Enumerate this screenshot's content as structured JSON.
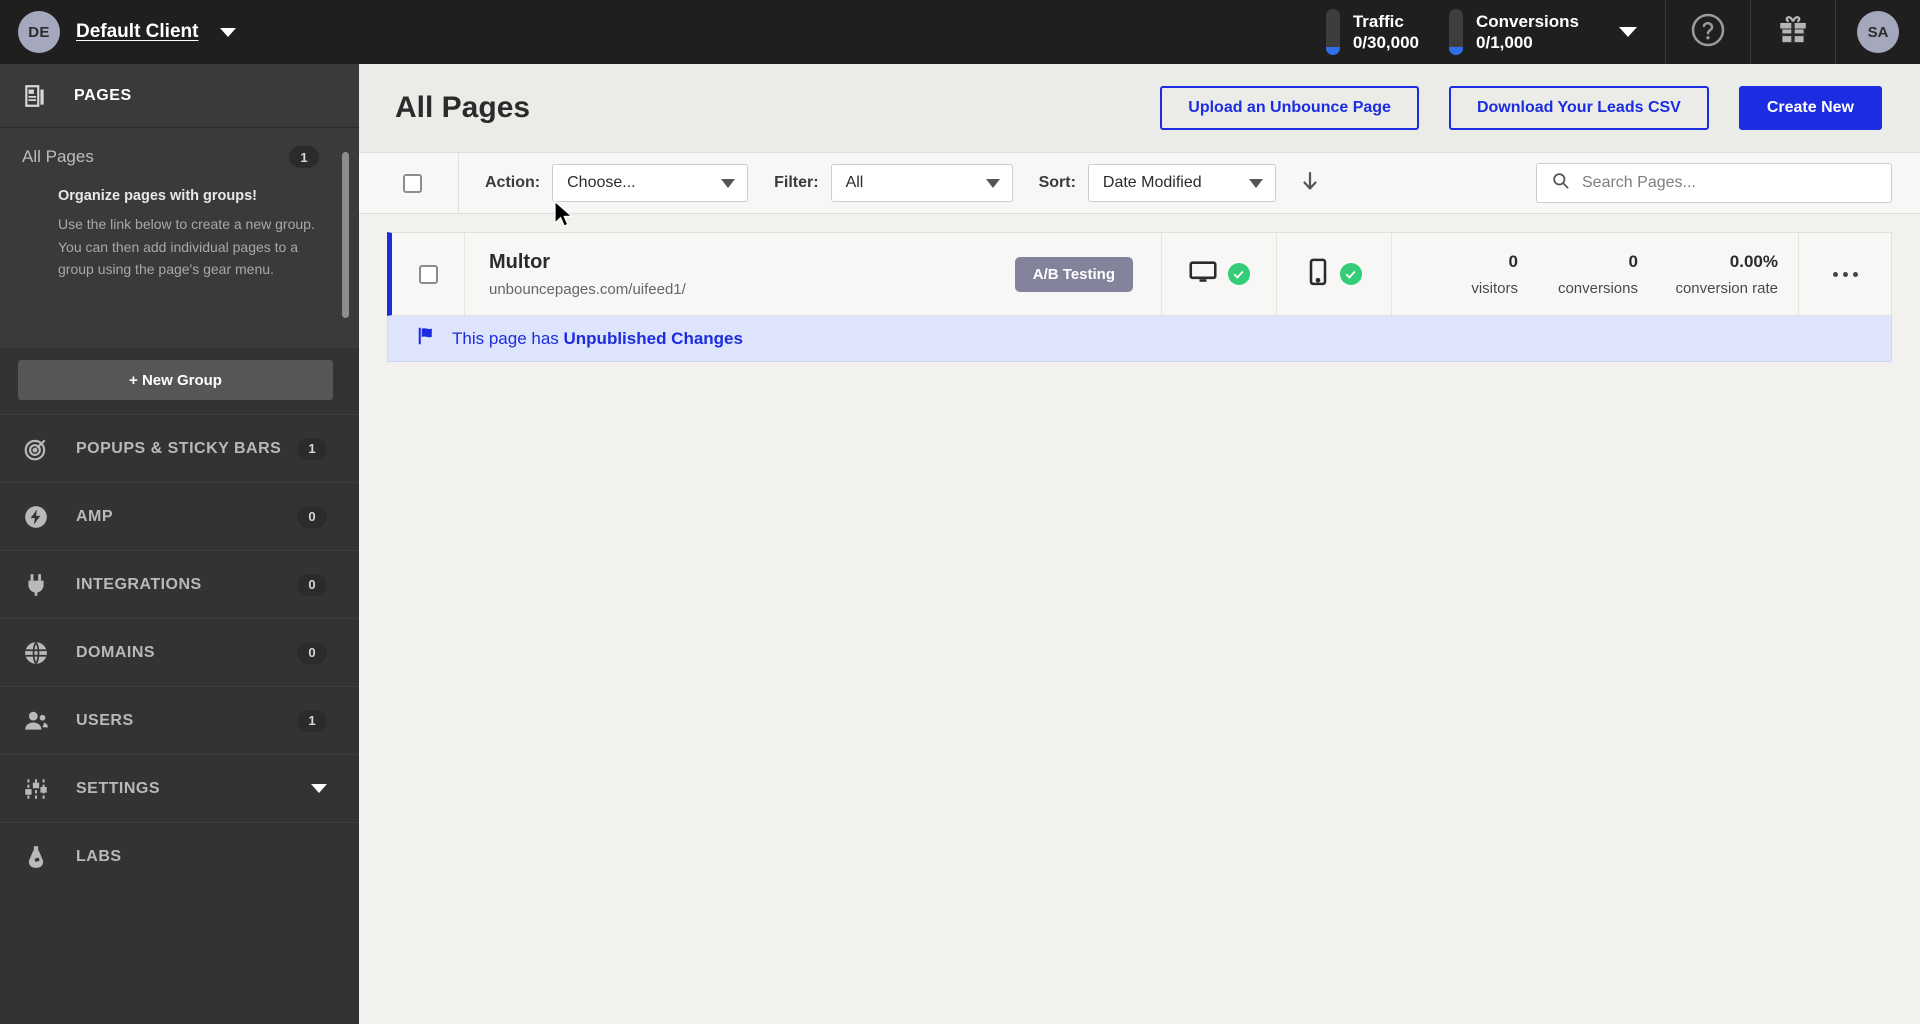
{
  "client": {
    "initials": "DE",
    "name": "Default Client",
    "caret_icon": "chevron-down-icon"
  },
  "sidebar": {
    "section_title": "PAGES",
    "section_icon": "pages-icon",
    "all_pages": {
      "label": "All Pages",
      "badge": "1"
    },
    "organize": {
      "title": "Organize pages with groups!",
      "text": "Use the link below to create a new group. You can then add individual pages to a group using the page's gear menu."
    },
    "new_group_label": "+ New Group",
    "items": [
      {
        "label": "POPUPS & STICKY BARS",
        "badge": "1",
        "icon": "target-icon"
      },
      {
        "label": "AMP",
        "badge": "0",
        "icon": "bolt-icon"
      },
      {
        "label": "INTEGRATIONS",
        "badge": "0",
        "icon": "plug-icon"
      },
      {
        "label": "DOMAINS",
        "badge": "0",
        "icon": "globe-icon"
      },
      {
        "label": "USERS",
        "badge": "1",
        "icon": "users-icon"
      },
      {
        "label": "SETTINGS",
        "badge": "",
        "icon": "sliders-icon"
      },
      {
        "label": "LABS",
        "badge": "",
        "icon": "flask-icon"
      }
    ]
  },
  "topbar": {
    "meters": [
      {
        "label": "Traffic",
        "value": "0/30,000"
      },
      {
        "label": "Conversions",
        "value": "0/1,000"
      }
    ],
    "expand_icon": "chevron-down-icon",
    "help_icon": "question-circle-icon",
    "gift_icon": "gift-icon",
    "avatar_initials": "SA"
  },
  "header": {
    "title": "All Pages",
    "buttons": [
      {
        "label": "Upload an Unbounce Page",
        "style": "outline"
      },
      {
        "label": "Download Your Leads CSV",
        "style": "outline"
      },
      {
        "label": "Create New",
        "style": "primary"
      }
    ]
  },
  "toolbar": {
    "action": {
      "label": "Action:",
      "value": "Choose..."
    },
    "filter": {
      "label": "Filter:",
      "value": "All"
    },
    "sort": {
      "label": "Sort:",
      "value": "Date Modified"
    },
    "sort_direction_icon": "arrow-down-icon",
    "search_placeholder": "Search Pages..."
  },
  "pages": [
    {
      "name": "Multor",
      "url": "unbouncepages.com/uifeed1/",
      "badge": "A/B Testing",
      "desktop_status": "published",
      "mobile_status": "published",
      "stats": [
        {
          "value": "0",
          "label": "visitors"
        },
        {
          "value": "0",
          "label": "conversions"
        },
        {
          "value": "0.00%",
          "label": "conversion rate"
        }
      ],
      "notice_prefix": "This page has ",
      "notice_strong": "Unpublished Changes"
    }
  ],
  "colors": {
    "brand_blue": "#1c2ce0",
    "sidebar_dark": "#333333",
    "topbar_dark": "#1f1f1f",
    "success_green": "#34cc76",
    "notice_bg": "#dde4fb",
    "badge_gray": "#83839c"
  }
}
